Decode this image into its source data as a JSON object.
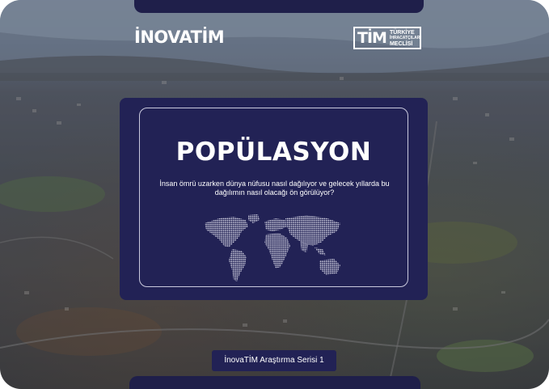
{
  "brand": {
    "left_logo": "İNOVATİM",
    "right_logo_main": "TİM",
    "right_logo_line1": "TÜRKİYE",
    "right_logo_line2": "İHRACATÇILAR",
    "right_logo_line3": "MECLİSİ"
  },
  "card": {
    "title": "POPÜLASYON",
    "description": "İnsan ömrü uzarken dünya nüfusu nasıl dağılıyor ve gelecek yıllarda bu dağılımın nasıl olacağı ön görülüyor?"
  },
  "footer": {
    "series_label": "İnovaTİM Araştırma Serisi 1"
  },
  "colors": {
    "navy": "#222255",
    "pill": "#1f1f4a",
    "text": "#ffffff"
  },
  "icons": [
    "world-map-icon"
  ]
}
